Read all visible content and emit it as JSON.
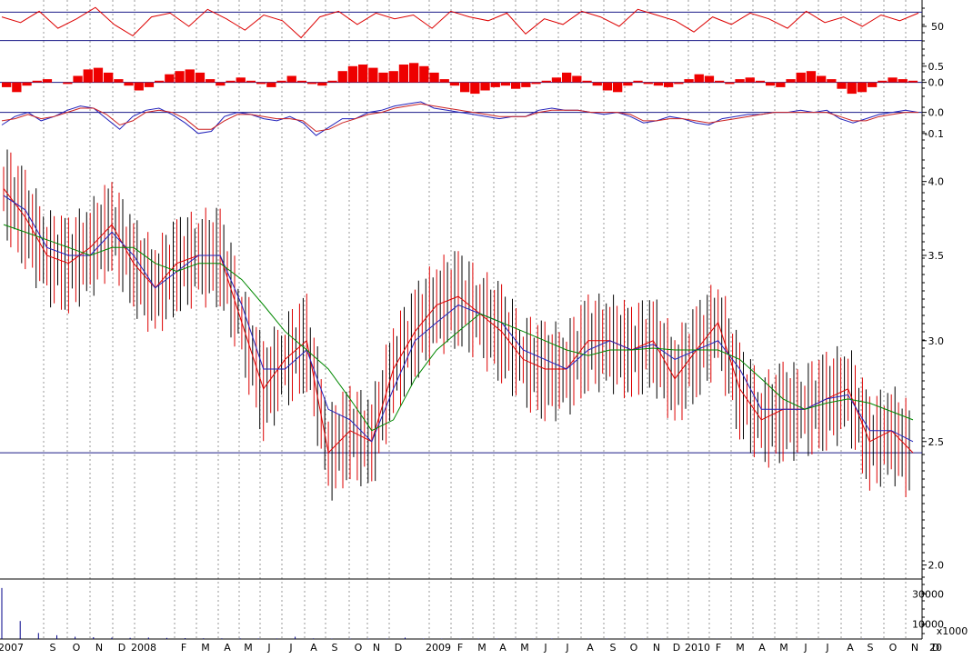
{
  "chart_data": [
    {
      "type": "line",
      "panel": "oscillator-rsi",
      "ylim": [
        25,
        75
      ],
      "reference_lines": [
        65,
        35
      ],
      "y_tick_labels": [
        "50"
      ],
      "y_ticks": [
        50
      ],
      "series": [
        {
          "color": "#dd0000",
          "y": [
            60,
            54,
            66,
            48,
            58,
            70,
            52,
            40,
            60,
            64,
            50,
            68,
            58,
            46,
            62,
            56,
            38,
            60,
            66,
            52,
            64,
            58,
            62,
            48,
            66,
            60,
            56,
            64,
            42,
            58,
            52,
            66,
            60,
            50,
            68,
            62,
            56,
            44,
            60,
            52,
            64,
            58,
            48,
            66,
            54,
            60,
            50,
            62,
            56,
            64
          ]
        }
      ]
    },
    {
      "type": "bar",
      "panel": "oscillator-momentum",
      "ylim": [
        -0.6,
        1.0
      ],
      "y_tick_labels": [
        "0.5",
        "0.0"
      ],
      "y_ticks": [
        0.5,
        0.0
      ],
      "series": [
        {
          "color": "#ee0000",
          "y": [
            -0.15,
            -0.3,
            -0.1,
            0.05,
            0.1,
            0.0,
            -0.05,
            0.2,
            0.4,
            0.45,
            0.3,
            0.1,
            -0.1,
            -0.25,
            -0.15,
            0.05,
            0.25,
            0.35,
            0.4,
            0.3,
            0.1,
            -0.1,
            0.05,
            0.15,
            0.05,
            -0.05,
            -0.15,
            0.05,
            0.2,
            0.05,
            -0.05,
            -0.1,
            0.05,
            0.35,
            0.5,
            0.55,
            0.45,
            0.3,
            0.35,
            0.55,
            0.6,
            0.5,
            0.3,
            0.1,
            -0.1,
            -0.3,
            -0.35,
            -0.25,
            -0.15,
            -0.1,
            -0.2,
            -0.15,
            -0.05,
            0.05,
            0.15,
            0.3,
            0.2,
            0.05,
            -0.1,
            -0.25,
            -0.3,
            -0.1,
            0.05,
            -0.05,
            -0.1,
            -0.15,
            -0.05,
            0.1,
            0.25,
            0.2,
            0.05,
            -0.05,
            0.1,
            0.15,
            0.05,
            -0.1,
            -0.15,
            0.1,
            0.3,
            0.35,
            0.2,
            0.1,
            -0.2,
            -0.35,
            -0.3,
            -0.15,
            0.05,
            0.15,
            0.1,
            0.05
          ]
        }
      ]
    },
    {
      "type": "line",
      "panel": "oscillator-macd",
      "ylim": [
        -0.2,
        0.05
      ],
      "y_tick_labels": [
        "0.0",
        "-0.1"
      ],
      "y_ticks": [
        0.0,
        -0.1
      ],
      "series": [
        {
          "color": "#2222bb",
          "y": [
            -0.06,
            -0.02,
            0.0,
            -0.04,
            -0.02,
            0.01,
            0.03,
            0.02,
            -0.03,
            -0.08,
            -0.02,
            0.01,
            0.02,
            -0.01,
            -0.05,
            -0.1,
            -0.09,
            -0.02,
            0.0,
            -0.01,
            -0.03,
            -0.04,
            -0.02,
            -0.05,
            -0.11,
            -0.07,
            -0.03,
            -0.03,
            0.0,
            0.01,
            0.03,
            0.04,
            0.05,
            0.02,
            0.01,
            0.0,
            -0.01,
            -0.02,
            -0.03,
            -0.02,
            -0.02,
            0.01,
            0.02,
            0.01,
            0.01,
            0.0,
            -0.01,
            0.0,
            -0.02,
            -0.05,
            -0.04,
            -0.02,
            -0.03,
            -0.05,
            -0.06,
            -0.03,
            -0.02,
            -0.01,
            -0.01,
            0.0,
            0.0,
            0.01,
            0.0,
            0.01,
            -0.03,
            -0.05,
            -0.03,
            -0.01,
            0.0,
            0.01,
            0.0
          ]
        },
        {
          "color": "#cc2222",
          "y": [
            -0.04,
            -0.03,
            -0.01,
            -0.03,
            -0.02,
            0.0,
            0.02,
            0.02,
            -0.01,
            -0.06,
            -0.04,
            0.0,
            0.01,
            0.0,
            -0.03,
            -0.08,
            -0.08,
            -0.04,
            -0.01,
            -0.01,
            -0.02,
            -0.03,
            -0.03,
            -0.04,
            -0.09,
            -0.08,
            -0.05,
            -0.03,
            -0.01,
            0.0,
            0.02,
            0.03,
            0.04,
            0.03,
            0.02,
            0.01,
            0.0,
            -0.01,
            -0.02,
            -0.02,
            -0.02,
            0.0,
            0.01,
            0.01,
            0.01,
            0.0,
            0.0,
            0.0,
            -0.01,
            -0.04,
            -0.04,
            -0.03,
            -0.03,
            -0.04,
            -0.05,
            -0.04,
            -0.03,
            -0.02,
            -0.01,
            0.0,
            0.0,
            0.0,
            0.0,
            0.0,
            -0.02,
            -0.04,
            -0.04,
            -0.02,
            -0.01,
            0.0,
            0.0
          ]
        }
      ]
    },
    {
      "type": "line",
      "panel": "price",
      "scale": "log",
      "ylim": [
        1.95,
        4.2
      ],
      "y_tick_labels": [
        "4.0",
        "3.5",
        "3.0",
        "2.5",
        "2.0"
      ],
      "y_ticks": [
        4.0,
        3.5,
        3.0,
        2.5,
        2.0
      ],
      "reference_lines": [
        2.45
      ],
      "x": [
        "2007-07",
        "2007-08",
        "2007-09",
        "2007-10",
        "2007-11",
        "2007-12",
        "2008-01",
        "2008-02",
        "2008-03",
        "2008-04",
        "2008-05",
        "2008-06",
        "2008-07",
        "2008-08",
        "2008-09",
        "2008-10",
        "2008-11",
        "2008-12",
        "2009-01",
        "2009-02",
        "2009-03",
        "2009-04",
        "2009-05",
        "2009-06",
        "2009-07",
        "2009-08",
        "2009-09",
        "2009-10",
        "2009-11",
        "2009-12",
        "2010-01",
        "2010-02",
        "2010-03",
        "2010-04",
        "2010-05",
        "2010-06",
        "2010-07",
        "2010-08",
        "2010-09",
        "2010-10",
        "2010-11",
        "2010-12",
        "2011-01"
      ],
      "series": [
        {
          "color": "#dd0000",
          "y": [
            3.95,
            3.75,
            3.5,
            3.45,
            3.55,
            3.7,
            3.45,
            3.3,
            3.45,
            3.5,
            3.5,
            3.1,
            2.75,
            2.9,
            3.0,
            2.45,
            2.55,
            2.5,
            2.85,
            3.05,
            3.2,
            3.25,
            3.15,
            3.05,
            2.9,
            2.85,
            2.85,
            3.0,
            3.0,
            2.95,
            3.0,
            2.8,
            2.95,
            3.1,
            2.75,
            2.6,
            2.65,
            2.65,
            2.7,
            2.75,
            2.5,
            2.55,
            2.45
          ]
        },
        {
          "color": "#2222bb",
          "y": [
            3.9,
            3.8,
            3.55,
            3.5,
            3.5,
            3.65,
            3.5,
            3.3,
            3.4,
            3.5,
            3.5,
            3.2,
            2.85,
            2.85,
            2.95,
            2.65,
            2.6,
            2.5,
            2.75,
            3.0,
            3.1,
            3.2,
            3.15,
            3.1,
            2.95,
            2.9,
            2.85,
            2.95,
            3.0,
            2.95,
            2.98,
            2.9,
            2.95,
            3.0,
            2.85,
            2.65,
            2.65,
            2.65,
            2.7,
            2.72,
            2.55,
            2.55,
            2.5
          ]
        },
        {
          "color": "#008800",
          "y": [
            3.7,
            3.65,
            3.6,
            3.55,
            3.5,
            3.55,
            3.55,
            3.45,
            3.4,
            3.45,
            3.45,
            3.35,
            3.2,
            3.05,
            2.95,
            2.85,
            2.7,
            2.55,
            2.6,
            2.8,
            2.95,
            3.05,
            3.15,
            3.1,
            3.05,
            3.0,
            2.95,
            2.92,
            2.95,
            2.95,
            2.96,
            2.95,
            2.95,
            2.95,
            2.9,
            2.8,
            2.7,
            2.65,
            2.68,
            2.7,
            2.68,
            2.64,
            2.6
          ]
        }
      ]
    },
    {
      "type": "bar",
      "panel": "volume",
      "y_tick_labels": [
        "30000",
        "10000"
      ],
      "y_ticks": [
        30000,
        10000
      ],
      "unit": "x1000",
      "series": [
        {
          "color": "#000088",
          "y": [
            34000,
            12000,
            4000,
            2500,
            1500,
            1200,
            900,
            800,
            1000,
            700,
            600,
            500,
            450,
            400,
            380,
            350,
            1500,
            400,
            300,
            300,
            250,
            250,
            900,
            280,
            260,
            240,
            230,
            220,
            210,
            200,
            300,
            200,
            190,
            180,
            170,
            170,
            160,
            160,
            150,
            150,
            140,
            140,
            130,
            130,
            130,
            120,
            120,
            120,
            110,
            110
          ]
        }
      ]
    }
  ],
  "x_axis": {
    "month_labels": [
      "2007",
      "S",
      "O",
      "N",
      "D",
      "2008",
      "F",
      "M",
      "A",
      "M",
      "J",
      "J",
      "A",
      "S",
      "O",
      "N",
      "D",
      "2009",
      "F",
      "M",
      "A",
      "M",
      "J",
      "J",
      "A",
      "S",
      "O",
      "N",
      "D",
      "2010",
      "F",
      "M",
      "A",
      "M",
      "J",
      "J",
      "A",
      "S",
      "O",
      "N",
      "D",
      "20"
    ]
  },
  "volume_unit_label": "x1000",
  "colors": {
    "background": "#ffffff",
    "grid": "#9a9a9a",
    "reference_line": "#1a1a88",
    "price_red": "#dd0000",
    "price_blue": "#2222bb",
    "price_green": "#008800"
  }
}
